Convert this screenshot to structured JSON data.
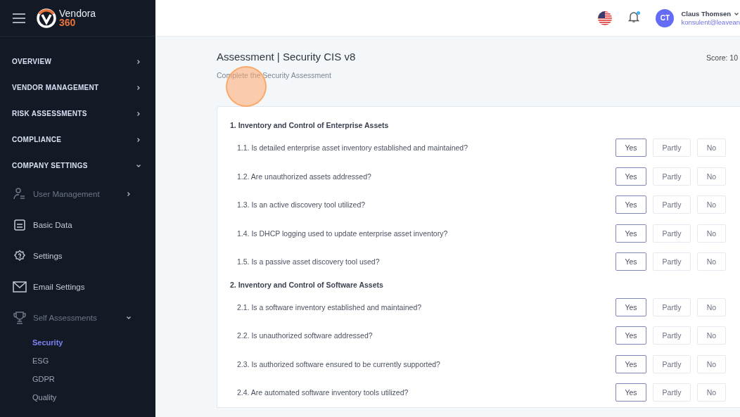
{
  "brand": {
    "name": "Vendora",
    "suffix": "360"
  },
  "sidebar": {
    "sections": [
      {
        "label": "OVERVIEW",
        "expanded": false
      },
      {
        "label": "VENDOR MANAGEMENT",
        "expanded": false
      },
      {
        "label": "RISK ASSESSMENTS",
        "expanded": false
      },
      {
        "label": "COMPLIANCE",
        "expanded": false
      },
      {
        "label": "COMPANY SETTINGS",
        "expanded": true,
        "children": [
          {
            "label": "User Management",
            "kind": "user",
            "expanded": false
          },
          {
            "label": "Basic Data",
            "kind": "card"
          },
          {
            "label": "Settings",
            "kind": "gear"
          },
          {
            "label": "Email Settings",
            "kind": "mail"
          },
          {
            "label": "Self Assessments",
            "kind": "trophy",
            "expanded": true,
            "children": [
              {
                "label": "Security",
                "selected": true
              },
              {
                "label": "ESG",
                "selected": false
              },
              {
                "label": "GDPR",
                "selected": false
              },
              {
                "label": "Quality",
                "selected": false
              }
            ]
          }
        ]
      }
    ]
  },
  "header": {
    "user": {
      "initials": "CT",
      "name": "Claus Thomsen",
      "email": "konsulent@leavean"
    },
    "notification_unread": true
  },
  "page": {
    "title": "Assessment | Security CIS v8",
    "subtitle": "Complete the Security Assessment",
    "score": "Score: 10"
  },
  "sections": [
    {
      "title": "1. Inventory and Control of Enterprise Assets",
      "questions": [
        {
          "text": "1.1. Is detailed enterprise asset inventory established and maintained?",
          "options": [
            {
              "label": "Yes",
              "selected": true
            },
            {
              "label": "Partly",
              "selected": false
            },
            {
              "label": "No",
              "selected": false
            }
          ]
        },
        {
          "text": "1.2. Are unauthorized assets addressed?",
          "options": [
            {
              "label": "Yes",
              "selected": true
            },
            {
              "label": "Partly",
              "selected": false
            },
            {
              "label": "No",
              "selected": false
            }
          ]
        },
        {
          "text": "1.3. Is an active discovery tool utilized?",
          "options": [
            {
              "label": "Yes",
              "selected": true
            },
            {
              "label": "Partly",
              "selected": false
            },
            {
              "label": "No",
              "selected": false
            }
          ]
        },
        {
          "text": "1.4. Is DHCP logging used to update enterprise asset inventory?",
          "options": [
            {
              "label": "Yes",
              "selected": true
            },
            {
              "label": "Partly",
              "selected": false
            },
            {
              "label": "No",
              "selected": false
            }
          ]
        },
        {
          "text": "1.5. Is a passive asset discovery tool used?",
          "options": [
            {
              "label": "Yes",
              "selected": true
            },
            {
              "label": "Partly",
              "selected": false
            },
            {
              "label": "No",
              "selected": false
            }
          ]
        }
      ]
    },
    {
      "title": "2. Inventory and Control of Software Assets",
      "questions": [
        {
          "text": "2.1. Is a software inventory established and maintained?",
          "options": [
            {
              "label": "Yes",
              "selected": true
            },
            {
              "label": "Partly",
              "selected": false
            },
            {
              "label": "No",
              "selected": false
            }
          ]
        },
        {
          "text": "2.2. Is unauthorized software addressed?",
          "options": [
            {
              "label": "Yes",
              "selected": true
            },
            {
              "label": "Partly",
              "selected": false
            },
            {
              "label": "No",
              "selected": false
            }
          ]
        },
        {
          "text": "2.3. Is authorized software ensured to be currently supported?",
          "options": [
            {
              "label": "Yes",
              "selected": true
            },
            {
              "label": "Partly",
              "selected": false
            },
            {
              "label": "No",
              "selected": false
            }
          ]
        },
        {
          "text": "2.4. Are automated software inventory tools utilized?",
          "options": [
            {
              "label": "Yes",
              "selected": true
            },
            {
              "label": "Partly",
              "selected": false
            },
            {
              "label": "No",
              "selected": false
            }
          ]
        }
      ]
    }
  ]
}
